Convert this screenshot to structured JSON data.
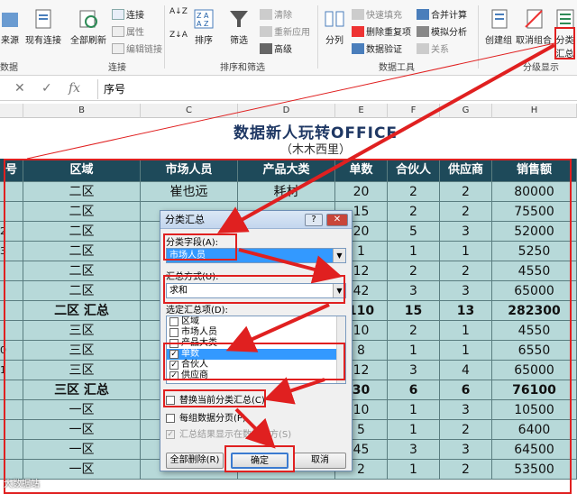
{
  "ribbon": {
    "data_tools": {
      "source": "来源",
      "existing_conn": "现有连接",
      "refresh_all": "全部刷新",
      "connections": "连接",
      "properties": "属性",
      "edit_links": "编辑链接"
    },
    "sort_filter": {
      "sort": "排序",
      "filter": "筛选",
      "clear": "清除",
      "reapply": "重新应用",
      "advanced": "高级"
    },
    "data_tools_grp": {
      "split": "分列",
      "flash_fill": "快速填充",
      "remove_dup": "删除重复项",
      "validation": "数据验证",
      "consolidate": "合并计算",
      "what_if": "模拟分析",
      "relationships": "关系"
    },
    "outline": {
      "group": "创建组",
      "ungroup": "取消组合",
      "subtotal": "分类汇总"
    },
    "group_labels": {
      "g1": "数据",
      "g2": "连接",
      "g3": "排序和筛选",
      "g4": "数据工具",
      "g5": "分级显示"
    }
  },
  "formula_bar": {
    "cancel": "✕",
    "enter": "✓",
    "fx": "fx",
    "content": "序号"
  },
  "columns": [
    "B",
    "C",
    "D",
    "E",
    "F",
    "G",
    "H"
  ],
  "sheet": {
    "title": "数据新人玩转OFFICE",
    "subtitle": "（木木西里）",
    "headers": [
      "号",
      "区域",
      "市场人员",
      "产品大类",
      "单数",
      "合伙人",
      "供应商",
      "销售额"
    ],
    "rows": [
      {
        "rn": "",
        "cells": [
          "二区",
          "崔也远",
          "耗材",
          "20",
          "2",
          "2",
          "80000"
        ]
      },
      {
        "rn": "",
        "cells": [
          "二区",
          "",
          "",
          "15",
          "2",
          "2",
          "75500"
        ]
      },
      {
        "rn": "2",
        "cells": [
          "二区",
          "",
          "",
          "20",
          "5",
          "3",
          "52000"
        ]
      },
      {
        "rn": "3",
        "cells": [
          "二区",
          "",
          "",
          "1",
          "1",
          "1",
          "5250"
        ]
      },
      {
        "rn": "",
        "cells": [
          "二区",
          "",
          "",
          "12",
          "2",
          "2",
          "4550"
        ]
      },
      {
        "rn": "",
        "cells": [
          "二区",
          "",
          "",
          "42",
          "3",
          "3",
          "65000"
        ]
      },
      {
        "rn": "",
        "cells": [
          "二区 汇总",
          "",
          "",
          "110",
          "15",
          "13",
          "282300"
        ],
        "subtotal": true
      },
      {
        "rn": "",
        "cells": [
          "三区",
          "",
          "",
          "10",
          "2",
          "1",
          "4550"
        ]
      },
      {
        "rn": "0",
        "cells": [
          "三区",
          "",
          "",
          "8",
          "1",
          "1",
          "6550"
        ]
      },
      {
        "rn": "1",
        "cells": [
          "三区",
          "",
          "",
          "12",
          "3",
          "4",
          "65000"
        ]
      },
      {
        "rn": "",
        "cells": [
          "三区 汇总",
          "",
          "",
          "30",
          "6",
          "6",
          "76100"
        ],
        "subtotal": true
      },
      {
        "rn": "",
        "cells": [
          "一区",
          "",
          "",
          "10",
          "1",
          "3",
          "10500"
        ]
      },
      {
        "rn": "",
        "cells": [
          "一区",
          "",
          "",
          "5",
          "1",
          "2",
          "6400"
        ]
      },
      {
        "rn": "",
        "cells": [
          "一区",
          "",
          "",
          "45",
          "3",
          "3",
          "64500"
        ]
      },
      {
        "rn": "",
        "cells": [
          "一区",
          "",
          "",
          "2",
          "1",
          "2",
          "53500"
        ]
      }
    ]
  },
  "dialog": {
    "title": "分类汇总",
    "help": "?",
    "close": "✕",
    "group_by_label": "分类字段(A):",
    "group_by_value": "市场人员",
    "func_label": "汇总方式(U):",
    "func_value": "求和",
    "items_label": "选定汇总项(D):",
    "items": [
      {
        "label": "区域",
        "checked": false,
        "selected": false
      },
      {
        "label": "市场人员",
        "checked": false,
        "selected": false
      },
      {
        "label": "产品大类",
        "checked": false,
        "selected": false
      },
      {
        "label": "单数",
        "checked": true,
        "selected": true
      },
      {
        "label": "合伙人",
        "checked": true,
        "selected": false
      },
      {
        "label": "供应商",
        "checked": true,
        "selected": false
      }
    ],
    "replace_label": "替换当前分类汇总(C)",
    "pagebreak_label": "每组数据分页(P)",
    "below_label": "汇总结果显示在数据下方(S)",
    "remove_all": "全部删除(R)",
    "ok": "确定",
    "cancel": "取消"
  },
  "watermark": "大数据站"
}
